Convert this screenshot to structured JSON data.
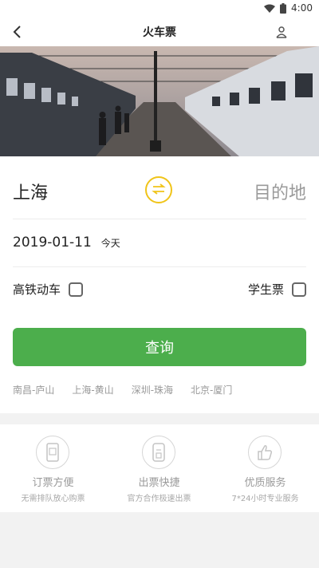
{
  "status_bar": {
    "time": "4:00",
    "icons": [
      "wifi-icon",
      "battery-icon"
    ]
  },
  "nav": {
    "title": "火车票",
    "back_icon": "chevron-left-icon",
    "user_icon": "user-location-icon"
  },
  "banner": {
    "image": "train-station-photo"
  },
  "form": {
    "from_city": "上海",
    "to_city": "目的地",
    "swap_icon": "swap-arrows-icon",
    "date": "2019-01-11",
    "date_hint": "今天",
    "option_highspeed": {
      "label": "高铁动车",
      "checked": false
    },
    "option_student": {
      "label": "学生票",
      "checked": false
    },
    "search_label": "查询"
  },
  "history": [
    "南昌-庐山",
    "上海-黄山",
    "深圳-珠海",
    "北京-厦门"
  ],
  "features": [
    {
      "title": "订票方便",
      "subtitle": "无需排队放心购票",
      "icon": "phone-ticket-icon"
    },
    {
      "title": "出票快捷",
      "subtitle": "官方合作极速出票",
      "icon": "ticket-icon"
    },
    {
      "title": "优质服务",
      "subtitle": "7*24小时专业服务",
      "icon": "thumbs-up-icon"
    }
  ],
  "colors": {
    "accent_green": "#4cae4c",
    "swap_yellow": "#f0c419",
    "muted_text": "#9a9a9a"
  }
}
